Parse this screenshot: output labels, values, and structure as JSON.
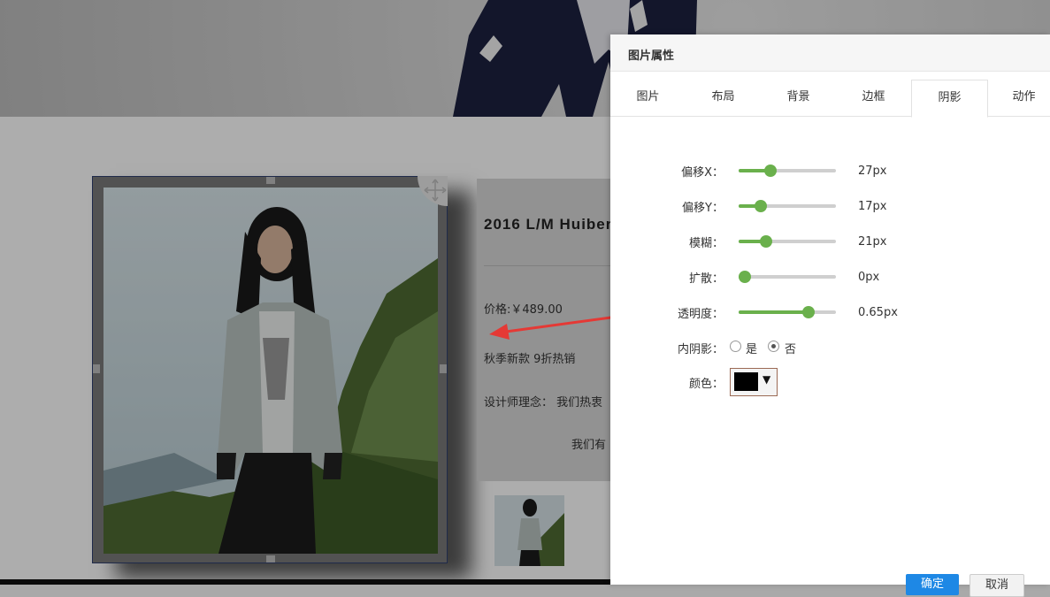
{
  "product": {
    "title": "2016  L/M  Huiber",
    "price": "价格:￥489.00",
    "promo": "秋季新款 9折热销",
    "designer": "设计师理念：  我们热衷",
    "more": "我们有"
  },
  "dialog": {
    "title": "图片属性",
    "tabs": [
      {
        "label": "图片"
      },
      {
        "label": "布局"
      },
      {
        "label": "背景"
      },
      {
        "label": "边框"
      },
      {
        "label": "阴影",
        "active": true
      },
      {
        "label": "动作"
      }
    ],
    "shadow": {
      "offset_x": {
        "label": "偏移X：",
        "value": "27px",
        "level": 0.33
      },
      "offset_y": {
        "label": "偏移Y：",
        "value": "17px",
        "level": 0.23
      },
      "blur": {
        "label": "模糊：",
        "value": "21px",
        "level": 0.28
      },
      "spread": {
        "label": "扩散：",
        "value": "0px",
        "level": 0.06
      },
      "opacity": {
        "label": "透明度：",
        "value": "0.65px",
        "level": 0.72
      },
      "inset": {
        "label": "内阴影：",
        "options": [
          "是",
          "否"
        ],
        "selected": "否"
      },
      "color": {
        "label": "颜色：",
        "hex": "#000000"
      }
    },
    "buttons": {
      "ok": "确定",
      "cancel": "取消"
    }
  },
  "colors": {
    "accent": "#6ab04c",
    "primary": "#1e88e5",
    "arrow": "#e53935"
  }
}
